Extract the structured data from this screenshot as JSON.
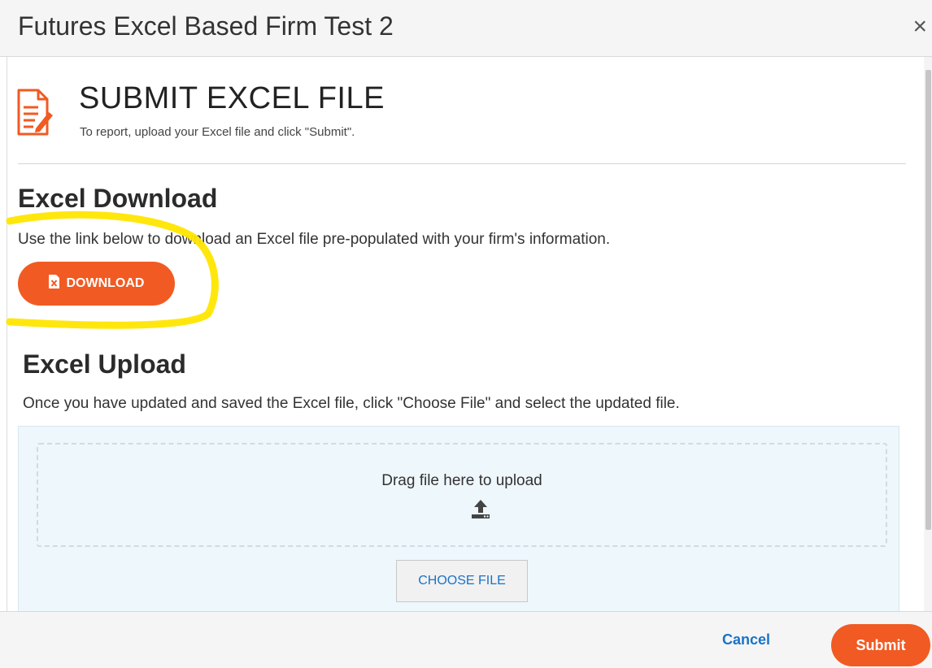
{
  "modal": {
    "title": "Futures Excel Based Firm Test 2",
    "close_symbol": "×"
  },
  "submit_section": {
    "icon": "document-edit-icon",
    "title": "SUBMIT EXCEL FILE",
    "subtitle": "To report, upload your Excel file and click \"Submit\"."
  },
  "excel_download": {
    "heading": "Excel Download",
    "description": "Use the link below to download an Excel file pre-populated with your firm's information.",
    "button_label": "DOWNLOAD",
    "button_icon": "excel-file-icon"
  },
  "excel_upload": {
    "heading": "Excel Upload",
    "description": "Once you have updated and saved the Excel file, click \"Choose File\" and select the updated file.",
    "drop_text": "Drag file here to upload",
    "drop_icon": "upload-icon",
    "choose_label": "CHOOSE FILE"
  },
  "footer": {
    "cancel_label": "Cancel",
    "submit_label": "Submit"
  },
  "colors": {
    "accent": "#f15a22",
    "link": "#1a73c8",
    "highlight": "#ffe600",
    "upload_bg": "#eef7fc"
  }
}
